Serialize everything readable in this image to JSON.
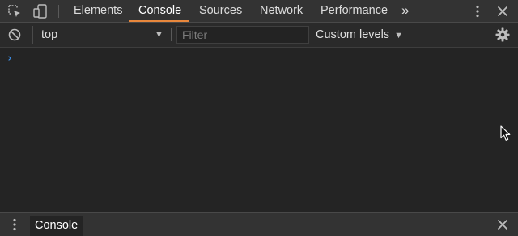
{
  "tabbar": {
    "tabs": [
      {
        "label": "Elements",
        "active": false
      },
      {
        "label": "Console",
        "active": true
      },
      {
        "label": "Sources",
        "active": false
      },
      {
        "label": "Network",
        "active": false
      },
      {
        "label": "Performance",
        "active": false
      }
    ],
    "overflow_label": "»"
  },
  "toolbar": {
    "context_value": "top",
    "filter_placeholder": "Filter",
    "filter_value": "",
    "levels_label": "Custom levels"
  },
  "console": {
    "prompt_symbol": "›"
  },
  "drawer": {
    "tab_label": "Console"
  },
  "colors": {
    "accent": "#e8873c",
    "prompt": "#3d8fe8",
    "background": "#242424",
    "toolbar_bg": "#333333"
  },
  "icons": [
    "inspect-icon",
    "device-toggle-icon",
    "kebab-menu-icon",
    "close-icon",
    "clear-console-icon",
    "dropdown-arrow-icon",
    "settings-gear-icon",
    "mouse-cursor-icon"
  ]
}
